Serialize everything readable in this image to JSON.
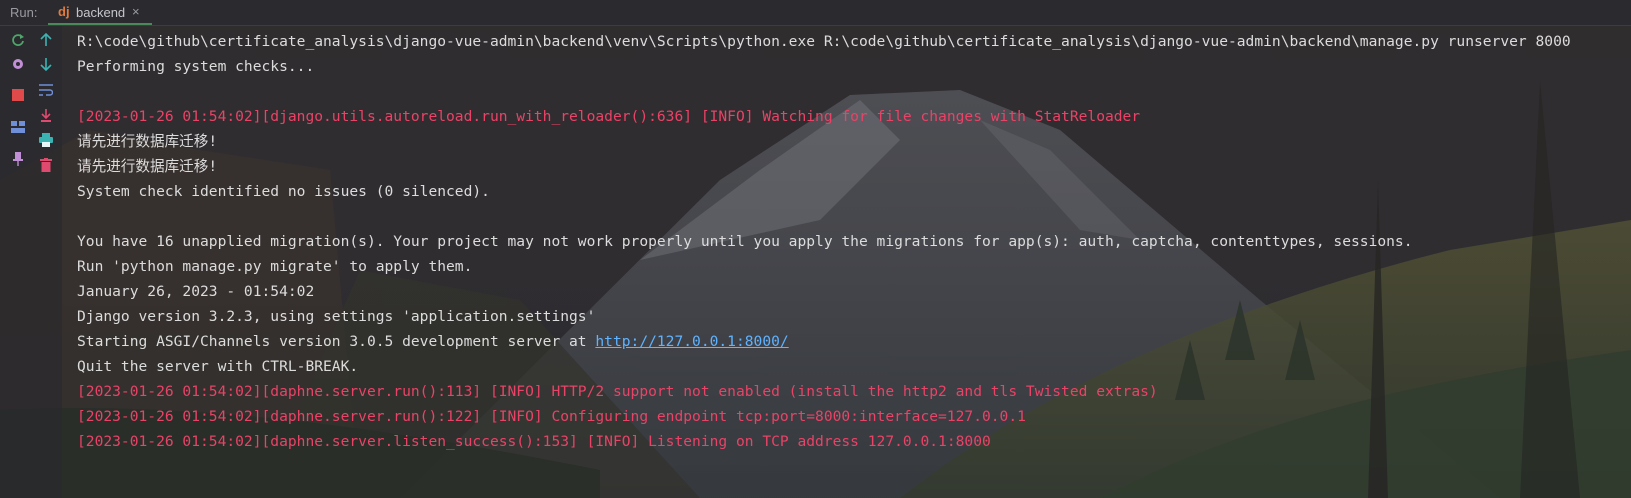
{
  "tabbar": {
    "run_label": "Run:",
    "tab_icon": "dj",
    "tab_name": "backend",
    "tab_close": "×"
  },
  "toolbar": {
    "left_column": [
      "rerun-icon",
      "settings-gear-icon",
      "stop-icon",
      "layout-icon",
      "pin-icon"
    ],
    "right_column": [
      "up-arrow-icon",
      "down-arrow-icon",
      "soft-wrap-icon",
      "scroll-to-end-icon",
      "print-icon",
      "trash-icon"
    ]
  },
  "colors": {
    "error_text": "#e94367",
    "normal_text": "#dcdcdc",
    "link": "#5fb3ff",
    "tab_underline": "#4a8a5a"
  },
  "console": {
    "lines": [
      {
        "text": "R:\\code\\github\\certificate_analysis\\django-vue-admin\\backend\\venv\\Scripts\\python.exe R:\\code\\github\\certificate_analysis\\django-vue-admin\\backend\\manage.py runserver 8000",
        "style": "normal"
      },
      {
        "text": "Performing system checks...",
        "style": "normal"
      },
      {
        "text": "",
        "style": "normal"
      },
      {
        "text": "[2023-01-26 01:54:02][django.utils.autoreload.run_with_reloader():636] [INFO] Watching for file changes with StatReloader",
        "style": "red"
      },
      {
        "text": "请先进行数据库迁移!",
        "style": "normal"
      },
      {
        "text": "请先进行数据库迁移!",
        "style": "normal"
      },
      {
        "text": "System check identified no issues (0 silenced).",
        "style": "normal"
      },
      {
        "text": "",
        "style": "normal"
      },
      {
        "text": "You have 16 unapplied migration(s). Your project may not work properly until you apply the migrations for app(s): auth, captcha, contenttypes, sessions.",
        "style": "normal"
      },
      {
        "text": "Run 'python manage.py migrate' to apply them.",
        "style": "normal"
      },
      {
        "text": "January 26, 2023 - 01:54:02",
        "style": "normal"
      },
      {
        "text": "Django version 3.2.3, using settings 'application.settings'",
        "style": "normal"
      },
      {
        "text": "Starting ASGI/Channels version 3.0.5 development server at ",
        "link": "http://127.0.0.1:8000/",
        "style": "normal"
      },
      {
        "text": "Quit the server with CTRL-BREAK.",
        "style": "normal"
      },
      {
        "text": "[2023-01-26 01:54:02][daphne.server.run():113] [INFO] HTTP/2 support not enabled (install the http2 and tls Twisted extras)",
        "style": "red"
      },
      {
        "text": "[2023-01-26 01:54:02][daphne.server.run():122] [INFO] Configuring endpoint tcp:port=8000:interface=127.0.0.1",
        "style": "red"
      },
      {
        "text": "[2023-01-26 01:54:02][daphne.server.listen_success():153] [INFO] Listening on TCP address 127.0.0.1:8000",
        "style": "red"
      }
    ]
  }
}
